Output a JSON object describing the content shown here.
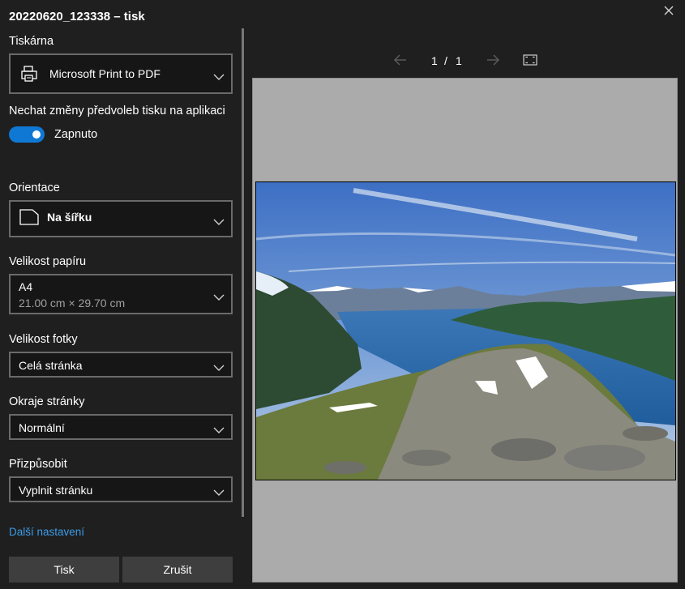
{
  "window": {
    "title": "20220620_123338 – tisk"
  },
  "printer": {
    "label": "Tiskárna",
    "value": "Microsoft Print to PDF"
  },
  "app_prefs": {
    "label": "Nechat změny předvoleb tisku na aplikaci",
    "toggle_text": "Zapnuto",
    "toggle_on": true
  },
  "orientation": {
    "label": "Orientace",
    "value": "Na šířku"
  },
  "paper_size": {
    "label": "Velikost papíru",
    "value": "A4",
    "detail": "21.00 cm × 29.70 cm"
  },
  "photo_size": {
    "label": "Velikost fotky",
    "value": "Celá stránka"
  },
  "margins": {
    "label": "Okraje stránky",
    "value": "Normální"
  },
  "fit": {
    "label": "Přizpůsobit",
    "value": "Vyplnit stránku"
  },
  "more_settings": "Další nastavení",
  "buttons": {
    "print": "Tisk",
    "cancel": "Zrušit"
  },
  "pager": {
    "current": "1",
    "separator": "/",
    "total": "1"
  },
  "colors": {
    "accent": "#0f78d4",
    "link": "#3c9be8",
    "background": "#1f1f1f",
    "preview_bg": "#ababab"
  },
  "icons": [
    "close-icon",
    "printer-icon",
    "chevron-down-icon",
    "page-icon",
    "arrow-left-icon",
    "arrow-right-icon",
    "fit-page-icon"
  ]
}
